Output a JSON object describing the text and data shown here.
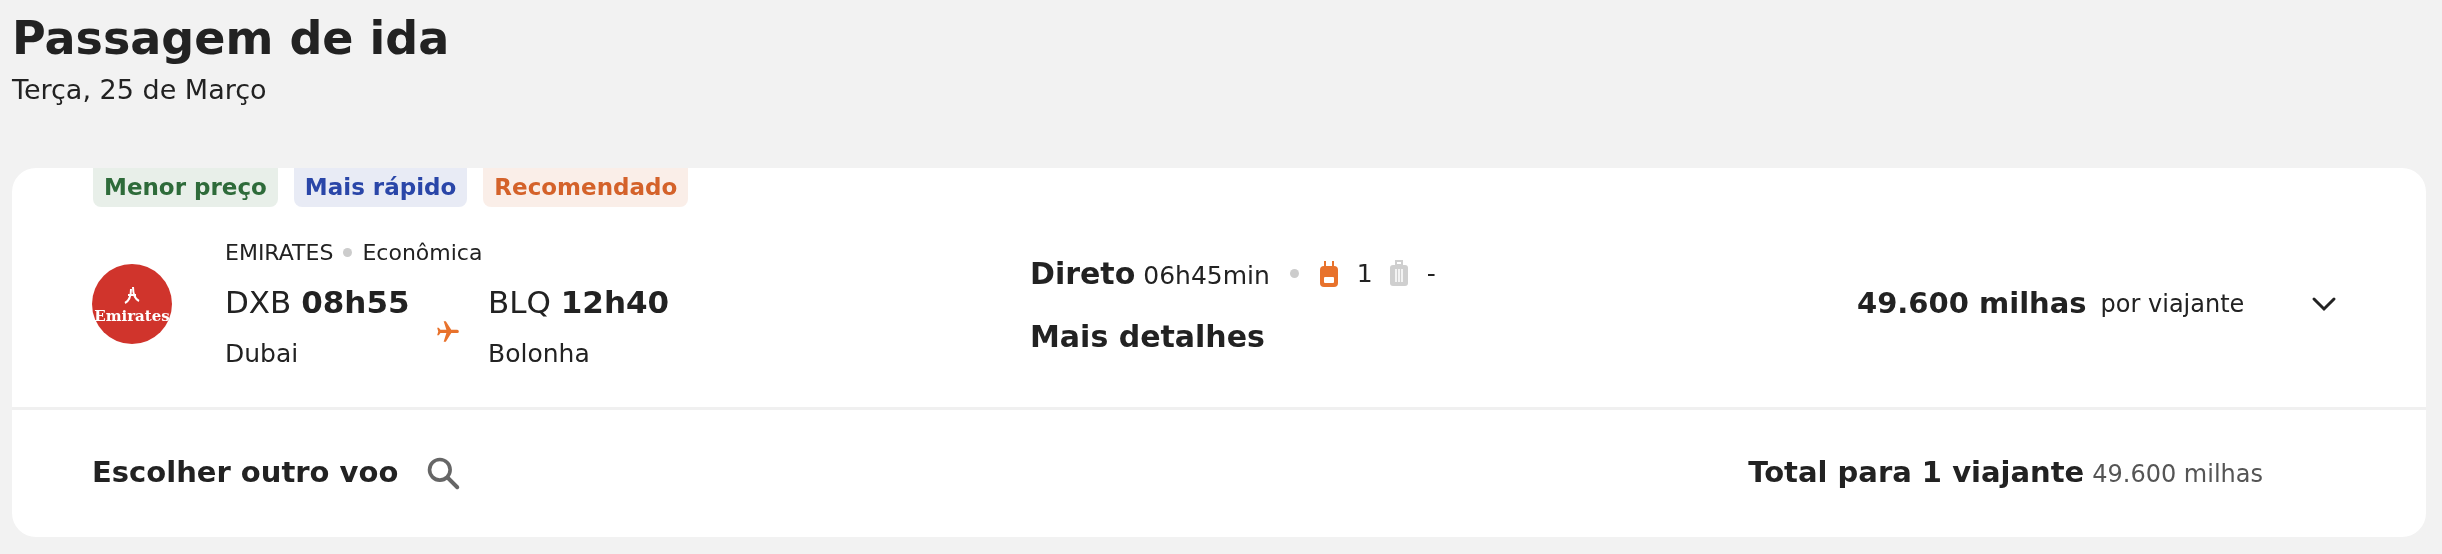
{
  "page": {
    "title": "Passagem de ida",
    "date": "Terça, 25 de Março"
  },
  "flight": {
    "badges": [
      {
        "label": "Menor preço",
        "color": "#2e6b3a"
      },
      {
        "label": "Mais rápido",
        "color": "#2a46a8"
      },
      {
        "label": "Recomendado",
        "color": "#d4622a"
      }
    ],
    "logo_text": "Emirates",
    "airline": "EMIRATES",
    "cabin": "Econômica",
    "departure": {
      "code": "DXB",
      "time": "08h55",
      "city": "Dubai"
    },
    "arrival": {
      "code": "BLQ",
      "time": "12h40",
      "city": "Bolonha"
    },
    "stops": "Direto",
    "duration": "06h45min",
    "bags": [
      {
        "kind": "backpack",
        "included": true,
        "count": "1"
      },
      {
        "kind": "suitcase",
        "included": false,
        "count": "-"
      }
    ],
    "details_link": "Mais detalhes",
    "price": "49.600 milhas",
    "price_note": "por viajante",
    "expanded": false
  },
  "footer": {
    "choose_other": "Escolher outro voo",
    "total_label": "Total para 1 viajante",
    "total_value": "49.600 milhas"
  }
}
